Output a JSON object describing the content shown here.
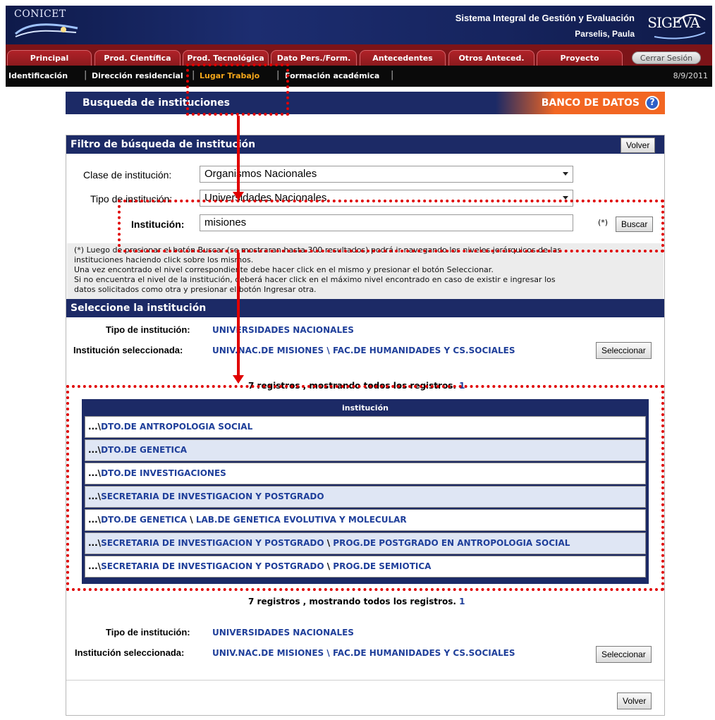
{
  "header": {
    "org": "CONICET",
    "system_title": "Sistema Integral de Gestión y Evaluación",
    "user": "Parselis, Paula",
    "logo_text": "SIGEVA"
  },
  "tabs": [
    {
      "label": "Principal"
    },
    {
      "label": "Prod. Científica"
    },
    {
      "label": "Prod. Tecnológica"
    },
    {
      "label": "Dato Pers./Form."
    },
    {
      "label": "Antecedentes"
    },
    {
      "label": "Otros Anteced."
    },
    {
      "label": "Proyecto"
    }
  ],
  "logout_label": "Cerrar Sesión",
  "subnav": {
    "items": [
      "Identificación",
      "Dirección residencial",
      "Lugar Trabajo",
      "Formación académica"
    ],
    "active": "Lugar Trabajo",
    "date": "8/9/2011"
  },
  "page": {
    "title": "Busqueda de instituciones",
    "bank": "BANCO DE DATOS",
    "help": "?"
  },
  "filter": {
    "heading": "Filtro de búsqueda de institución",
    "back_label": "Volver",
    "clase_label": "Clase de institución:",
    "clase_value": "Organismos Nacionales",
    "tipo_label": "Tipo de institución:",
    "tipo_value": "Universidades Nacionales",
    "inst_label": "Institución:",
    "inst_value": "misiones",
    "required_mark": "(*)",
    "search_label": "Buscar",
    "note": [
      "(*) Luego de presionar el botón Buscar (se mostraran hasta 300 resultados) podrá ir navegando los niveles jerárquicos de las",
      "instituciones haciendo click sobre los mismos.",
      "Una vez encontrado el nivel correspondiente debe hacer click en el mismo y presionar el botón Seleccionar.",
      "Si no encuentra el nivel de la institución, deberá hacer click en el máximo nivel encontrado en caso de existir e ingresar los",
      "datos solicitados como otra y presionar el botón Ingresar otra."
    ]
  },
  "select": {
    "heading": "Seleccione la institución",
    "tipo_label": "Tipo de institución:",
    "tipo_value": "UNIVERSIDADES NACIONALES",
    "sel_label": "Institución seleccionada:",
    "sel_part1": "UNIV.NAC.DE MISIONES",
    "sel_sep": " \\ ",
    "sel_part2": "FAC.DE HUMANIDADES Y CS.SOCIALES",
    "select_label": "Seleccionar",
    "count_text": "7 registros , mostrando todos los registros.",
    "page_link": "1"
  },
  "table": {
    "header": "institución",
    "rows": [
      {
        "prefix": "...\\",
        "parts": [
          "DTO.DE ANTROPOLOGIA SOCIAL"
        ]
      },
      {
        "prefix": "...\\",
        "parts": [
          "DTO.DE GENETICA"
        ]
      },
      {
        "prefix": "...\\",
        "parts": [
          "DTO.DE INVESTIGACIONES"
        ]
      },
      {
        "prefix": "...\\",
        "parts": [
          "SECRETARIA DE INVESTIGACION Y POSTGRADO"
        ]
      },
      {
        "prefix": "...\\",
        "parts": [
          "DTO.DE GENETICA",
          "LAB.DE GENETICA EVOLUTIVA Y MOLECULAR"
        ]
      },
      {
        "prefix": "...\\",
        "parts": [
          "SECRETARIA DE INVESTIGACION Y POSTGRADO",
          "PROG.DE POSTGRADO EN ANTROPOLOGIA SOCIAL"
        ]
      },
      {
        "prefix": "...\\",
        "parts": [
          "SECRETARIA DE INVESTIGACION Y POSTGRADO",
          "PROG.DE SEMIOTICA"
        ]
      }
    ]
  },
  "colors": {
    "navy": "#1c2a66",
    "tab_red": "#7c1418",
    "active_nav": "#f4a61a",
    "link_blue": "#1f3f9a",
    "annotation_red": "#e00000"
  }
}
